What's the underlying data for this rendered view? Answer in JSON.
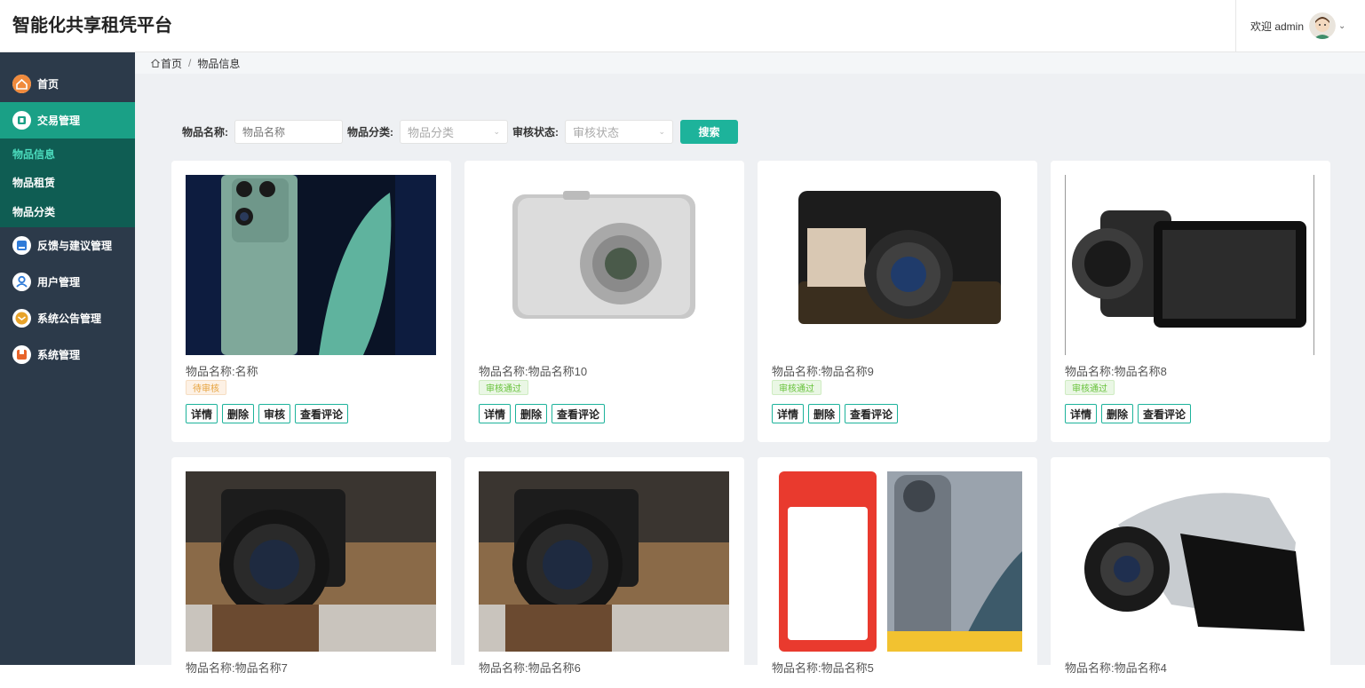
{
  "app": {
    "title": "智能化共享租凭平台"
  },
  "user": {
    "greeting": "欢迎 admin"
  },
  "sidebar": {
    "items": [
      {
        "label": "首页",
        "icon": "home-icon",
        "color": "#f08a3c"
      },
      {
        "label": "交易管理",
        "icon": "wallet-icon",
        "color": "#1aa086",
        "active": true
      },
      {
        "label": "反馈与建议管理",
        "icon": "feedback-icon",
        "color": "#2f7bd8"
      },
      {
        "label": "用户管理",
        "icon": "user-icon",
        "color": "#2f7bd8"
      },
      {
        "label": "系统公告管理",
        "icon": "notice-icon",
        "color": "#e8a32a"
      },
      {
        "label": "系统管理",
        "icon": "settings-icon",
        "color": "#e8642a"
      }
    ],
    "sub_items": [
      "物品信息",
      "物品租赁",
      "物品分类"
    ]
  },
  "breadcrumb": {
    "home": "首页",
    "current": "物品信息"
  },
  "search": {
    "name_label": "物品名称:",
    "name_placeholder": "物品名称",
    "category_label": "物品分类:",
    "category_placeholder": "物品分类",
    "status_label": "审核状态:",
    "status_placeholder": "审核状态",
    "button": "搜索"
  },
  "actions": {
    "detail": "详情",
    "delete": "删除",
    "review": "审核",
    "comments": "查看评论"
  },
  "cards": [
    {
      "name": "物品名称:名称",
      "status": "待审核",
      "status_type": "pending",
      "image": "phone-image",
      "can_review": true
    },
    {
      "name": "物品名称:物品名称10",
      "status": "审核通过",
      "status_type": "approved",
      "image": "sony-camera-image",
      "can_review": false
    },
    {
      "name": "物品名称:物品名称9",
      "status": "审核通过",
      "status_type": "approved",
      "image": "samsung-camera-image",
      "can_review": false
    },
    {
      "name": "物品名称:物品名称8",
      "status": "审核通过",
      "status_type": "approved",
      "image": "camcorder-image",
      "can_review": false
    },
    {
      "name": "物品名称:物品名称7",
      "image": "canon-dslr-image"
    },
    {
      "name": "物品名称:物品名称6",
      "image": "canon-dslr-image"
    },
    {
      "name": "物品名称:物品名称5",
      "image": "oneplus-phone-image"
    },
    {
      "name": "物品名称:物品名称4",
      "image": "samsung-camcorder-image"
    }
  ]
}
